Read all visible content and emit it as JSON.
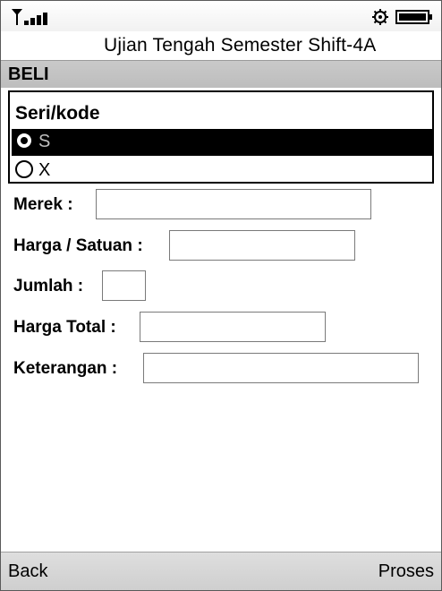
{
  "window": {
    "title": "Ujian Tengah Semester Shift-4A"
  },
  "form": {
    "heading": "BELI",
    "choice_group": {
      "label": "Seri/kode",
      "options": [
        {
          "label": "S",
          "selected": true
        },
        {
          "label": "X",
          "selected": false
        }
      ]
    },
    "fields": [
      {
        "label": "Merek :",
        "value": ""
      },
      {
        "label": "Harga / Satuan :",
        "value": ""
      },
      {
        "label": "Jumlah :",
        "value": ""
      },
      {
        "label": "Harga Total :",
        "value": ""
      },
      {
        "label": "Keterangan :",
        "value": ""
      }
    ]
  },
  "softkeys": {
    "left": "Back",
    "right": "Proses"
  },
  "icons": {
    "status_left": "signal-strength-icon",
    "status_right": [
      "settings-gear-icon",
      "battery-icon"
    ]
  }
}
